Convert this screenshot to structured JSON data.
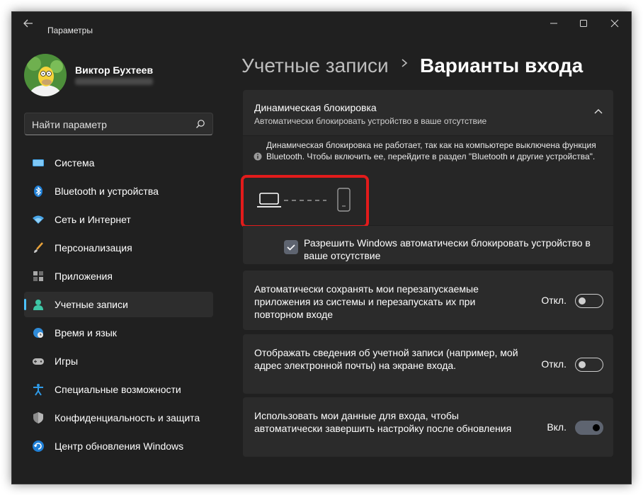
{
  "window": {
    "title": "Параметры",
    "controls": [
      "minimize-icon",
      "maximize-icon",
      "close-icon"
    ]
  },
  "user": {
    "name": "Виктор Бухтеев"
  },
  "search": {
    "placeholder": "Найти параметр"
  },
  "sidebar": {
    "items": [
      {
        "label": "Система",
        "icon": "monitor-icon",
        "active": false
      },
      {
        "label": "Bluetooth и устройства",
        "icon": "bluetooth-icon",
        "active": false
      },
      {
        "label": "Сеть и Интернет",
        "icon": "wifi-icon",
        "active": false
      },
      {
        "label": "Персонализация",
        "icon": "brush-icon",
        "active": false
      },
      {
        "label": "Приложения",
        "icon": "apps-icon",
        "active": false
      },
      {
        "label": "Учетные записи",
        "icon": "account-icon",
        "active": true
      },
      {
        "label": "Время и язык",
        "icon": "globe-clock-icon",
        "active": false
      },
      {
        "label": "Игры",
        "icon": "gamepad-icon",
        "active": false
      },
      {
        "label": "Специальные возможности",
        "icon": "accessibility-icon",
        "active": false
      },
      {
        "label": "Конфиденциальность и защита",
        "icon": "shield-icon",
        "active": false
      },
      {
        "label": "Центр обновления Windows",
        "icon": "update-icon",
        "active": false
      }
    ]
  },
  "breadcrumb": {
    "parent": "Учетные записи",
    "separator": ">",
    "current": "Варианты входа"
  },
  "dynamic_lock": {
    "title": "Динамическая блокировка",
    "subtitle": "Автоматически блокировать устройство в ваше отсутствие",
    "info": "Динамическая блокировка не работает, так как на компьютере выключена функция Bluetooth. Чтобы включить ее, перейдите в раздел \"Bluetooth и другие устройства\".",
    "checkbox_label": "Разрешить Windows автоматически блокировать устройство в ваше отсутствие",
    "checkbox_checked": true
  },
  "settings": [
    {
      "label": "Автоматически сохранять мои перезапускаемые приложения из системы и перезапускать их при повторном входе",
      "state": "Откл.",
      "on": false
    },
    {
      "label": "Отображать сведения об учетной записи (например, мой адрес электронной почты) на экране входа.",
      "state": "Откл.",
      "on": false
    },
    {
      "label": "Использовать мои данные для входа, чтобы автоматически завершить настройку после обновления",
      "state": "Вкл.",
      "on": true
    }
  ],
  "colors": {
    "accent": "#4cc2ff",
    "highlight_border": "#e21b1b",
    "background": "#202020",
    "card": "#2b2b2b"
  }
}
